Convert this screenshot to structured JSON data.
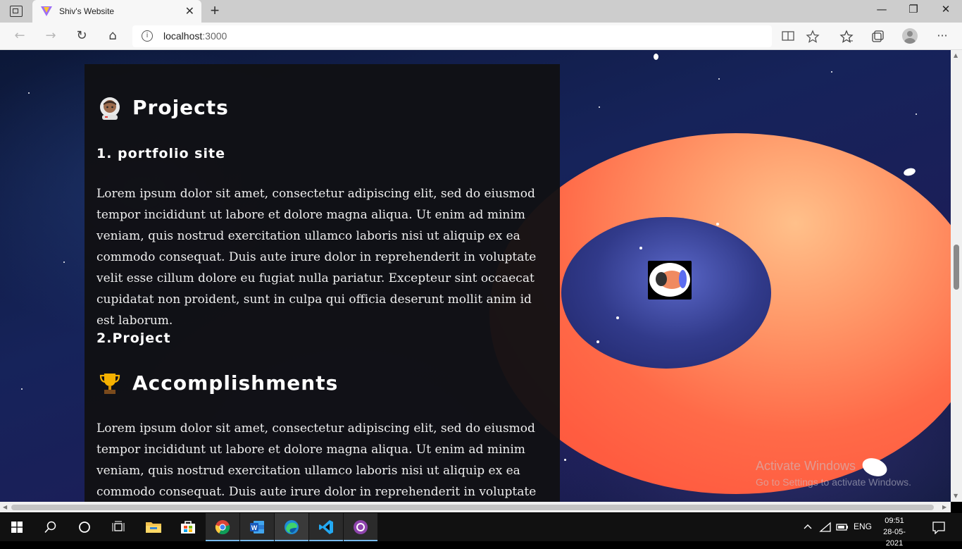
{
  "browser": {
    "tab_title": "Shiv's Website",
    "tab_close": "✕",
    "new_tab": "+",
    "url_host": "localhost",
    "url_port": ":3000",
    "window_controls": {
      "minimize": "—",
      "restore": "❐",
      "close": "✕"
    },
    "more": "···"
  },
  "page": {
    "projects_heading": "Projects",
    "project_1_title": "1. portfolio site",
    "project_1_text": "Lorem ipsum dolor sit amet, consectetur adipiscing elit, sed do eiusmod tempor incididunt ut labore et dolore magna aliqua. Ut enim ad minim veniam, quis nostrud exercitation ullamco laboris nisi ut aliquip ex ea commodo consequat. Duis aute irure dolor in reprehenderit in voluptate velit esse cillum dolore eu fugiat nulla pariatur. Excepteur sint occaecat cupidatat non proident, sunt in culpa qui officia deserunt mollit anim id est laborum.",
    "project_2_title": "2.Project",
    "accomplishments_heading": "Accomplishments",
    "accomplishments_text": "Lorem ipsum dolor sit amet, consectetur adipiscing elit, sed do eiusmod tempor incididunt ut labore et dolore magna aliqua. Ut enim ad minim veniam, quis nostrud exercitation ullamco laboris nisi ut aliquip ex ea commodo consequat. Duis aute irure dolor in reprehenderit in voluptate velit esse cillum dolore eu fugiat nulla"
  },
  "watermark": {
    "title": "Activate Windows",
    "subtitle": "Go to Settings to activate Windows."
  },
  "taskbar": {
    "apps": [
      "start-icon",
      "search-icon",
      "cortana-icon",
      "task-view-icon",
      "file-explorer-icon",
      "store-icon",
      "chrome-icon",
      "word-icon",
      "edge-icon",
      "vscode-icon",
      "github-desktop-icon"
    ],
    "language": "ENG",
    "time": "09:51",
    "date": "28-05-2021"
  },
  "colors": {
    "torus": "#ff6a48",
    "panel": "#111114",
    "taskbar": "#111111",
    "accent": "#76b9ed"
  }
}
